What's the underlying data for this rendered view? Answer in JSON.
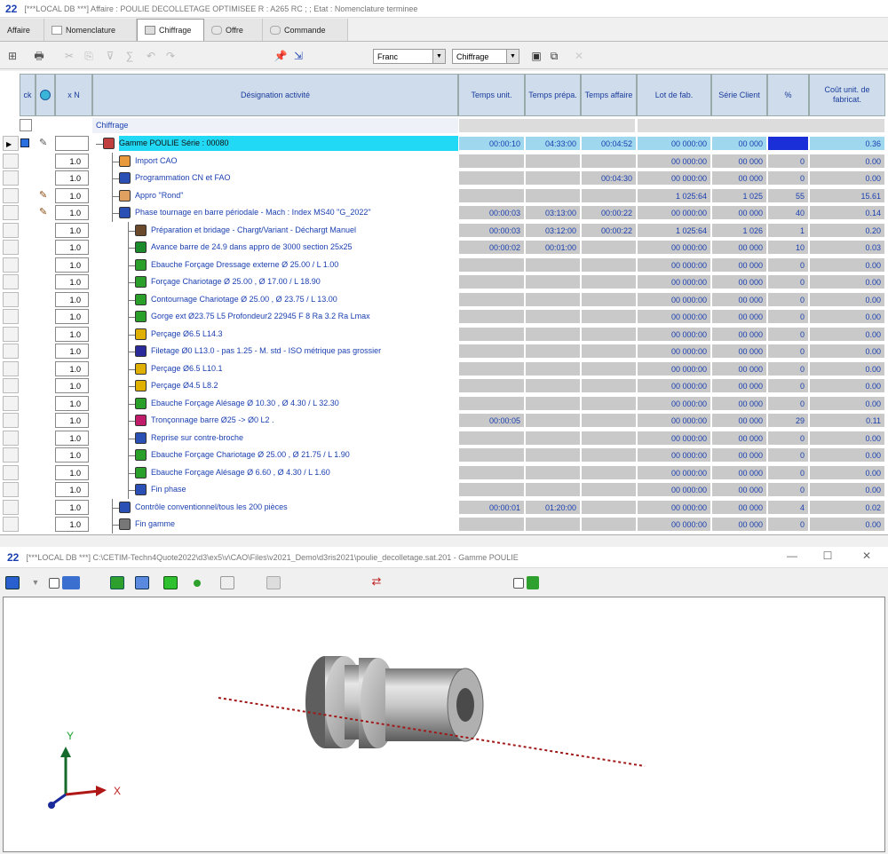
{
  "window1": {
    "logo": "22",
    "title": "[***LOCAL DB ***] Affaire : POULIE DECOLLETAGE OPTIMISEE R : A265 RC ; ; Etat : Nomenclature terminee"
  },
  "tabs": [
    {
      "label": "Affaire"
    },
    {
      "label": "Nomenclature"
    },
    {
      "label": "Chiffrage"
    },
    {
      "label": "Offre"
    },
    {
      "label": "Commande"
    }
  ],
  "toolbar": {
    "combo1": "Franc",
    "combo2": "Chiffrage"
  },
  "grid": {
    "headers": {
      "ck": "ck",
      "qty": "x N",
      "designation": "Désignation activité",
      "temps_unit": "Temps unit.",
      "temps_prepa": "Temps prépa.",
      "temps_affaire": "Temps affaire",
      "lot": "Lot de fab.",
      "serie": "Série Client",
      "pct": "%",
      "cout": "Coût unit. de fabricat."
    },
    "group_label": "Chiffrage",
    "rows": [
      {
        "qty": "",
        "des": "Gamme POULIE  Série : 00080",
        "tu": "00:00:10",
        "tp": "04:33:00",
        "ta": "00:04:52",
        "lot": "00 000:00",
        "serie": "00 000",
        "pct": "",
        "cout": "0.36",
        "level": 0,
        "icon": "gamme",
        "icon_color": "#c04040",
        "highlight": true
      },
      {
        "qty": "1.0",
        "des": "Import CAO",
        "tu": "",
        "tp": "",
        "ta": "",
        "lot": "00 000:00",
        "serie": "00 000",
        "pct": "0",
        "cout": "0.00",
        "level": 1,
        "icon": "folder",
        "icon_color": "#e89a3c"
      },
      {
        "qty": "1.0",
        "des": "Programmation CN et FAO",
        "tu": "",
        "tp": "",
        "ta": "00:04:30",
        "lot": "00 000:00",
        "serie": "00 000",
        "pct": "0",
        "cout": "0.00",
        "level": 1,
        "icon": "monitor",
        "icon_color": "#2a4fb5"
      },
      {
        "qty": "1.0",
        "des": "Appro \"Rond\"",
        "tu": "",
        "tp": "",
        "ta": "",
        "lot": "1 025:64",
        "serie": "1 025",
        "pct": "55",
        "cout": "15.61",
        "level": 1,
        "icon": "appro",
        "icon_color": "#e0a060"
      },
      {
        "qty": "1.0",
        "des": "Phase tournage en barre périodale - Mach : Index MS40 \"G_2022\"",
        "tu": "00:00:03",
        "tp": "03:13:00",
        "ta": "00:00:22",
        "lot": "00 000:00",
        "serie": "00 000",
        "pct": "40",
        "cout": "0.14",
        "level": 1,
        "icon": "gear",
        "icon_color": "#2a4fb5"
      },
      {
        "qty": "1.0",
        "des": "Préparation et bridage - Chargt/Variant - Déchargt Manuel",
        "tu": "00:00:03",
        "tp": "03:12:00",
        "ta": "00:00:22",
        "lot": "1 025:64",
        "serie": "1 026",
        "pct": "1",
        "cout": "0.20",
        "level": 2,
        "icon": "clamp",
        "icon_color": "#6a4a2a"
      },
      {
        "qty": "1.0",
        "des": "Avance barre de 24.9 dans appro de 3000 section 25x25",
        "tu": "00:00:02",
        "tp": "00:01:00",
        "ta": "",
        "lot": "00 000:00",
        "serie": "00 000",
        "pct": "10",
        "cout": "0.03",
        "level": 2,
        "icon": "advance",
        "icon_color": "#1a8a2a"
      },
      {
        "qty": "1.0",
        "des": "Ebauche Forçage Dressage externe  Ø 25.00 / L 1.00",
        "tu": "",
        "tp": "",
        "ta": "",
        "lot": "00 000:00",
        "serie": "00 000",
        "pct": "0",
        "cout": "0.00",
        "level": 2,
        "icon": "tool",
        "icon_color": "#2aa02a"
      },
      {
        "qty": "1.0",
        "des": "Forçage Chariotage  Ø 25.00 , Ø 17.00 / L 18.90",
        "tu": "",
        "tp": "",
        "ta": "",
        "lot": "00 000:00",
        "serie": "00 000",
        "pct": "0",
        "cout": "0.00",
        "level": 2,
        "icon": "tool",
        "icon_color": "#2aa02a"
      },
      {
        "qty": "1.0",
        "des": "Contournage  Chariotage  Ø 25.00 , Ø 23.75 / L 13.00",
        "tu": "",
        "tp": "",
        "ta": "",
        "lot": "00 000:00",
        "serie": "00 000",
        "pct": "0",
        "cout": "0.00",
        "level": 2,
        "icon": "tool",
        "icon_color": "#2aa02a"
      },
      {
        "qty": "1.0",
        "des": "Gorge ext Ø23.75 L5 Profondeur2 22945 F 8 Ra 3.2   Ra Lmax",
        "tu": "",
        "tp": "",
        "ta": "",
        "lot": "00 000:00",
        "serie": "00 000",
        "pct": "0",
        "cout": "0.00",
        "level": 2,
        "icon": "groove",
        "icon_color": "#2aa02a"
      },
      {
        "qty": "1.0",
        "des": "Perçage Ø6.5 L14.3",
        "tu": "",
        "tp": "",
        "ta": "",
        "lot": "00 000:00",
        "serie": "00 000",
        "pct": "0",
        "cout": "0.00",
        "level": 2,
        "icon": "drill",
        "icon_color": "#e0b000"
      },
      {
        "qty": "1.0",
        "des": "Filetage Ø0 L13.0 - pas 1.25 - M. std   - ISO métrique pas grossier",
        "tu": "",
        "tp": "",
        "ta": "",
        "lot": "00 000:00",
        "serie": "00 000",
        "pct": "0",
        "cout": "0.00",
        "level": 2,
        "icon": "thread",
        "icon_color": "#2a2a9a"
      },
      {
        "qty": "1.0",
        "des": "Perçage Ø6.5 L10.1",
        "tu": "",
        "tp": "",
        "ta": "",
        "lot": "00 000:00",
        "serie": "00 000",
        "pct": "0",
        "cout": "0.00",
        "level": 2,
        "icon": "drill",
        "icon_color": "#e0b000"
      },
      {
        "qty": "1.0",
        "des": "Perçage Ø4.5 L8.2",
        "tu": "",
        "tp": "",
        "ta": "",
        "lot": "00 000:00",
        "serie": "00 000",
        "pct": "0",
        "cout": "0.00",
        "level": 2,
        "icon": "drill",
        "icon_color": "#e0b000"
      },
      {
        "qty": "1.0",
        "des": "Ebauche Forçage Alésage  Ø 10.30 , Ø 4.30 / L 32.30",
        "tu": "",
        "tp": "",
        "ta": "",
        "lot": "00 000:00",
        "serie": "00 000",
        "pct": "0",
        "cout": "0.00",
        "level": 2,
        "icon": "groove",
        "icon_color": "#2aa02a"
      },
      {
        "qty": "1.0",
        "des": "Tronçonnage barre Ø25 -> Ø0 L2 .",
        "tu": "00:00:05",
        "tp": "",
        "ta": "",
        "lot": "00 000:00",
        "serie": "00 000",
        "pct": "29",
        "cout": "0.11",
        "level": 2,
        "icon": "cut",
        "icon_color": "#c01c6a"
      },
      {
        "qty": "1.0",
        "des": "Reprise sur contre-broche",
        "tu": "",
        "tp": "",
        "ta": "",
        "lot": "00 000:00",
        "serie": "00 000",
        "pct": "0",
        "cout": "0.00",
        "level": 2,
        "icon": "reprise",
        "icon_color": "#2a4fb5"
      },
      {
        "qty": "1.0",
        "des": "Ebauche Forçage Chariotage  Ø 25.00 , Ø 21.75 / L 1.90",
        "tu": "",
        "tp": "",
        "ta": "",
        "lot": "00 000:00",
        "serie": "00 000",
        "pct": "0",
        "cout": "0.00",
        "level": 2,
        "icon": "tool",
        "icon_color": "#2aa02a"
      },
      {
        "qty": "1.0",
        "des": "Ebauche Forçage Alésage  Ø 6.60 , Ø 4.30 / L 1.60",
        "tu": "",
        "tp": "",
        "ta": "",
        "lot": "00 000:00",
        "serie": "00 000",
        "pct": "0",
        "cout": "0.00",
        "level": 2,
        "icon": "tool",
        "icon_color": "#2aa02a"
      },
      {
        "qty": "1.0",
        "des": "Fin phase",
        "tu": "",
        "tp": "",
        "ta": "",
        "lot": "00 000:00",
        "serie": "00 000",
        "pct": "0",
        "cout": "0.00",
        "level": 2,
        "icon": "arrow",
        "icon_color": "#2a4fb5"
      },
      {
        "qty": "1.0",
        "des": "Contrôle conventionnel/tous les 200 pièces",
        "tu": "00:00:01",
        "tp": "01:20:00",
        "ta": "",
        "lot": "00 000:00",
        "serie": "00 000",
        "pct": "4",
        "cout": "0.02",
        "level": 1,
        "icon": "control",
        "icon_color": "#2a4fb5"
      },
      {
        "qty": "1.0",
        "des": "Fin gamme",
        "tu": "",
        "tp": "",
        "ta": "",
        "lot": "00 000:00",
        "serie": "00 000",
        "pct": "0",
        "cout": "0.00",
        "level": 1,
        "icon": "end",
        "icon_color": "#777777"
      }
    ]
  },
  "window2": {
    "logo": "22",
    "title": "[***LOCAL DB ***] C:\\CETIM-Techn4Quote2022\\d3\\ex5\\v\\CAO\\Files\\v2021_Demo\\d3ris2021\\poulie_decolletage.sat.201 - Gamme POULIE",
    "minimize": "—",
    "maximize": "☐",
    "close": "✕"
  },
  "viewer": {
    "axis_y": "Y",
    "axis_x": "X"
  }
}
